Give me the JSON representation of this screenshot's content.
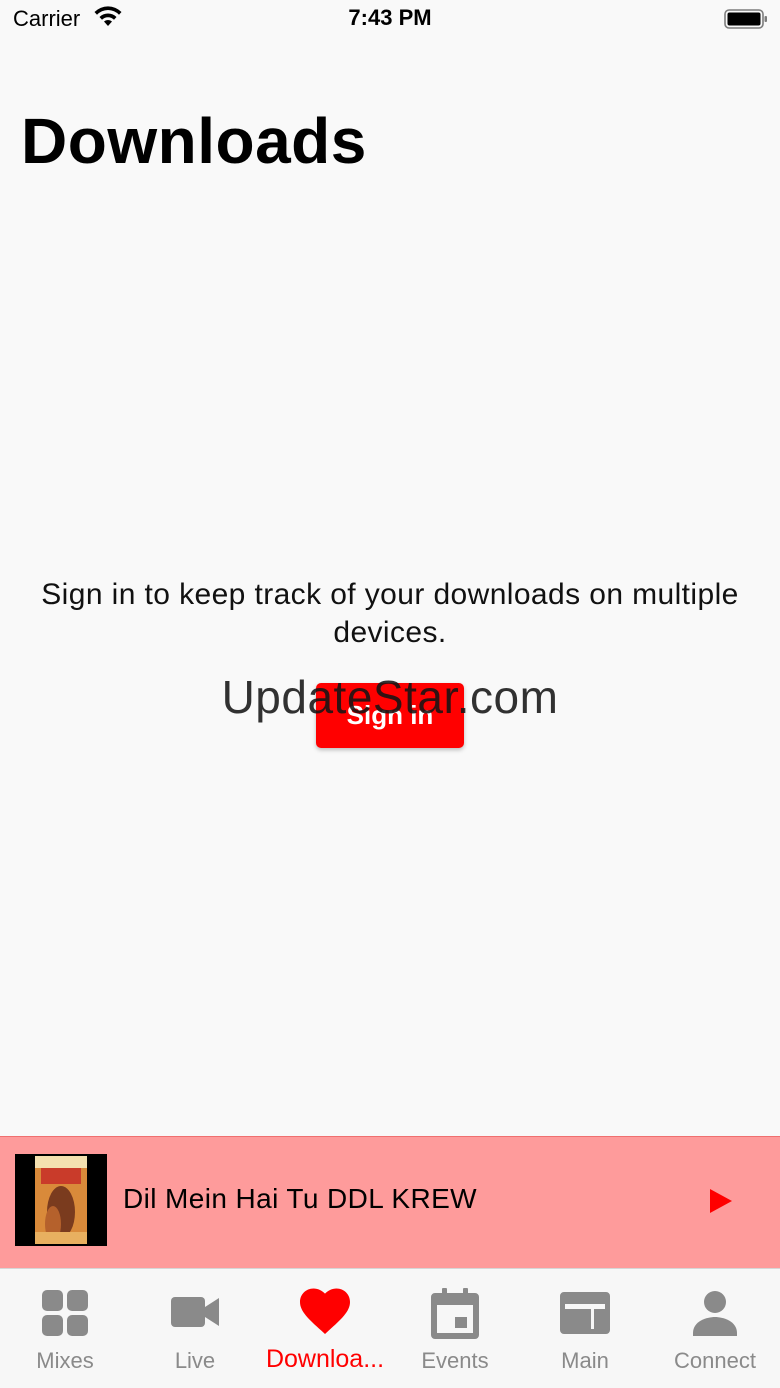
{
  "status_bar": {
    "carrier": "Carrier",
    "time": "7:43 PM"
  },
  "page": {
    "title": "Downloads"
  },
  "empty_state": {
    "message": "Sign in to keep track of your downloads on multiple devices.",
    "sign_in_label": "Sign in"
  },
  "watermark": "UpdateStar.com",
  "mini_player": {
    "track_title": "Dil Mein Hai Tu DDL KREW",
    "play_icon": "play-icon"
  },
  "tabs": [
    {
      "label": "Mixes",
      "icon": "grid-icon",
      "active": false
    },
    {
      "label": "Live",
      "icon": "video-camera-icon",
      "active": false
    },
    {
      "label": "Downloa...",
      "icon": "heart-icon",
      "active": true
    },
    {
      "label": "Events",
      "icon": "calendar-icon",
      "active": false
    },
    {
      "label": "Main",
      "icon": "browser-window-icon",
      "active": false
    },
    {
      "label": "Connect",
      "icon": "person-icon",
      "active": false
    }
  ],
  "colors": {
    "accent": "#ff0000",
    "mini_player_bg": "#fe9b9b",
    "tab_inactive": "#8a8a8a",
    "background": "#f9f9f9"
  }
}
